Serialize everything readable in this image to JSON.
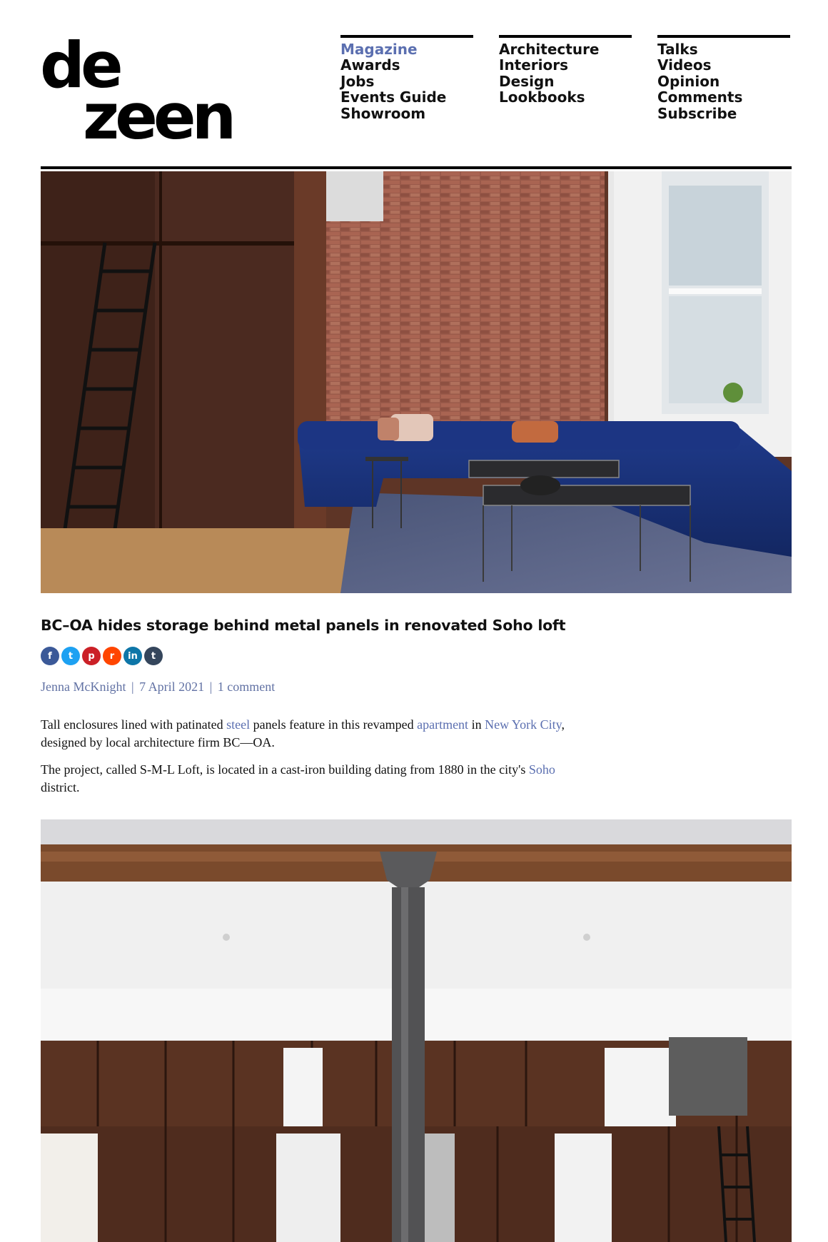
{
  "site": {
    "logo_line1": "de",
    "logo_line2": "zeen"
  },
  "nav": {
    "col1": [
      "Magazine",
      "Awards",
      "Jobs",
      "Events Guide",
      "Showroom"
    ],
    "col2": [
      "Architecture",
      "Interiors",
      "Design",
      "Lookbooks"
    ],
    "col3": [
      "Talks",
      "Videos",
      "Opinion",
      "Comments",
      "Subscribe"
    ],
    "active": "Magazine"
  },
  "article": {
    "title": "BC–OA hides storage behind metal panels in renovated Soho loft",
    "share_icons": [
      "facebook-icon",
      "twitter-icon",
      "pinterest-icon",
      "reddit-icon",
      "linkedin-icon",
      "tumblr-icon"
    ],
    "share_glyphs": {
      "facebook": "f",
      "twitter": "t",
      "pinterest": "p",
      "reddit": "r",
      "linkedin": "in",
      "tumblr": "t"
    },
    "author": "Jenna McKnight",
    "date": "7 April 2021",
    "comments": "1 comment",
    "separator": "|",
    "p1": {
      "t1": "Tall enclosures lined with patinated ",
      "link1": "steel",
      "t2": " panels feature in this revamped ",
      "link2": "apartment",
      "t3": " in ",
      "link3": "New York City",
      "t4": ", designed by local architecture firm BC—OA."
    },
    "p2": {
      "t1": "The project, called S-M-L Loft, is located in a cast-iron building dating from 1880 in the city's ",
      "link1": "Soho",
      "t2": " district."
    }
  },
  "colors": {
    "link": "#5b6fb0",
    "byline": "#6272a4",
    "text": "#111111"
  }
}
